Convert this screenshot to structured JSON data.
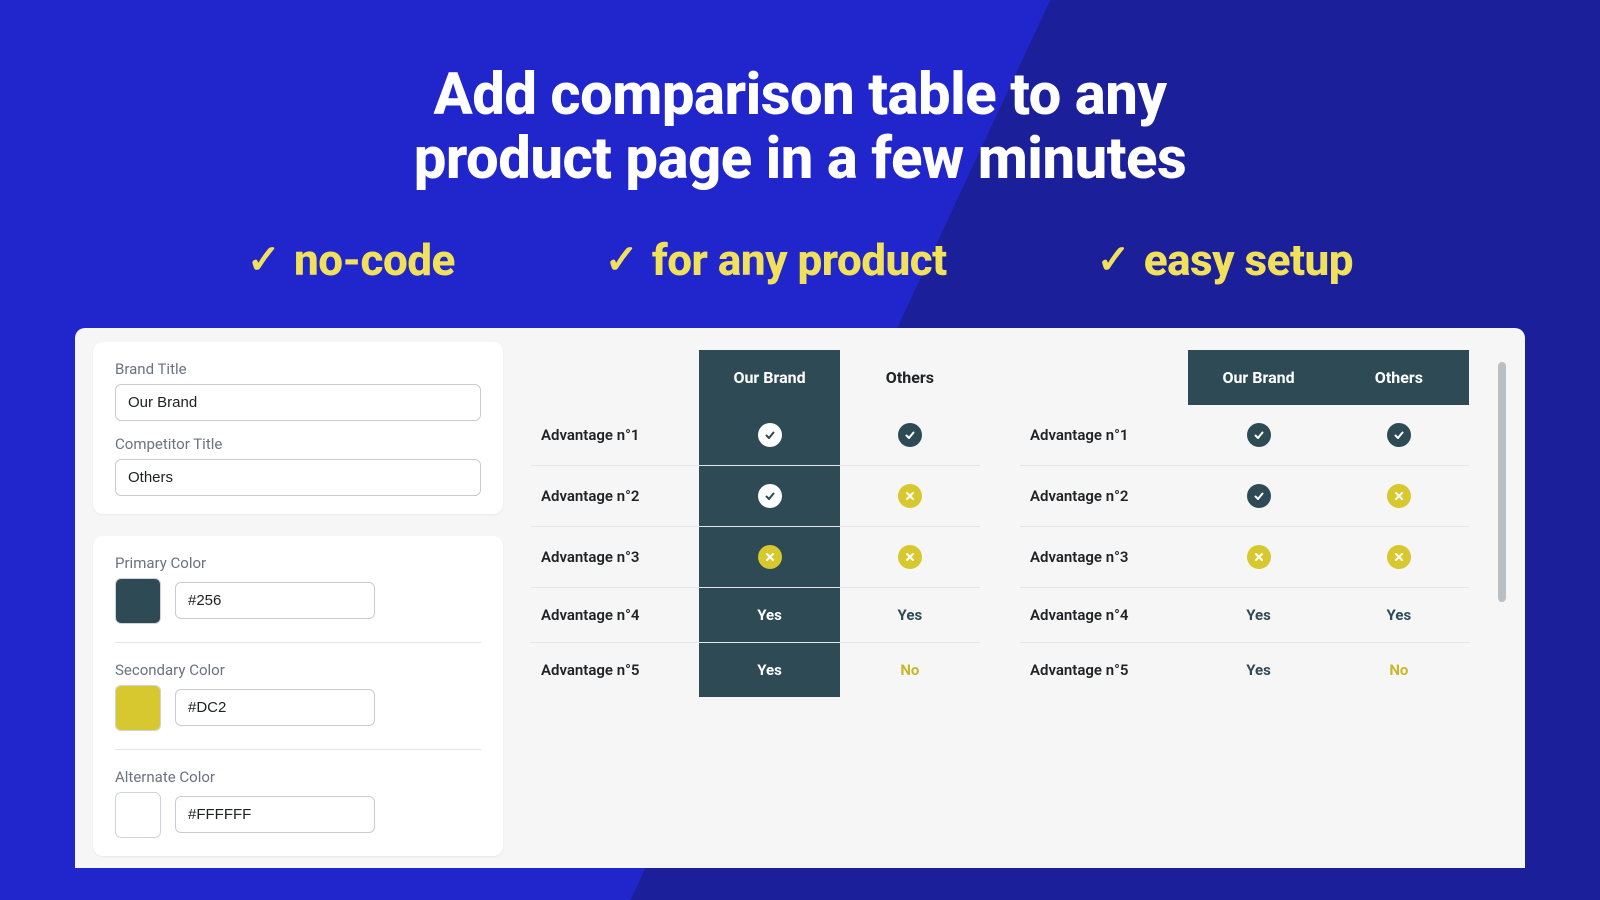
{
  "hero": {
    "headline_l1": "Add comparison table to any",
    "headline_l2": "product page in a few minutes",
    "features": [
      "no-code",
      "for any product",
      "easy setup"
    ]
  },
  "sidebar": {
    "brand_title_label": "Brand Title",
    "brand_title_value": "Our Brand",
    "competitor_title_label": "Competitor Title",
    "competitor_title_value": "Others",
    "primary_label": "Primary Color",
    "primary_value": "#256",
    "secondary_label": "Secondary Color",
    "secondary_value": "#DC2",
    "alternate_label": "Alternate Color",
    "alternate_value": "#FFFFFF"
  },
  "table": {
    "header_ours": "Our Brand",
    "header_others": "Others",
    "rows": [
      {
        "label": "Advantage n°1",
        "a_ours": "check-light",
        "a_others": "check-dark",
        "b_ours": "check-dark",
        "b_others": "check-dark"
      },
      {
        "label": "Advantage n°2",
        "a_ours": "check-light",
        "a_others": "cross-gold",
        "b_ours": "check-dark",
        "b_others": "cross-gold"
      },
      {
        "label": "Advantage n°3",
        "a_ours": "cross-gold",
        "a_others": "cross-gold",
        "b_ours": "cross-gold",
        "b_others": "cross-gold"
      },
      {
        "label": "Advantage n°4",
        "a_ours_text": "Yes",
        "a_others_text": "Yes",
        "b_ours_text": "Yes",
        "b_others_text": "Yes"
      },
      {
        "label": "Advantage n°5",
        "a_ours_text": "Yes",
        "a_others_text": "No",
        "a_others_gold": true,
        "b_ours_text": "Yes",
        "b_others_text": "No",
        "b_others_gold": true
      }
    ]
  }
}
